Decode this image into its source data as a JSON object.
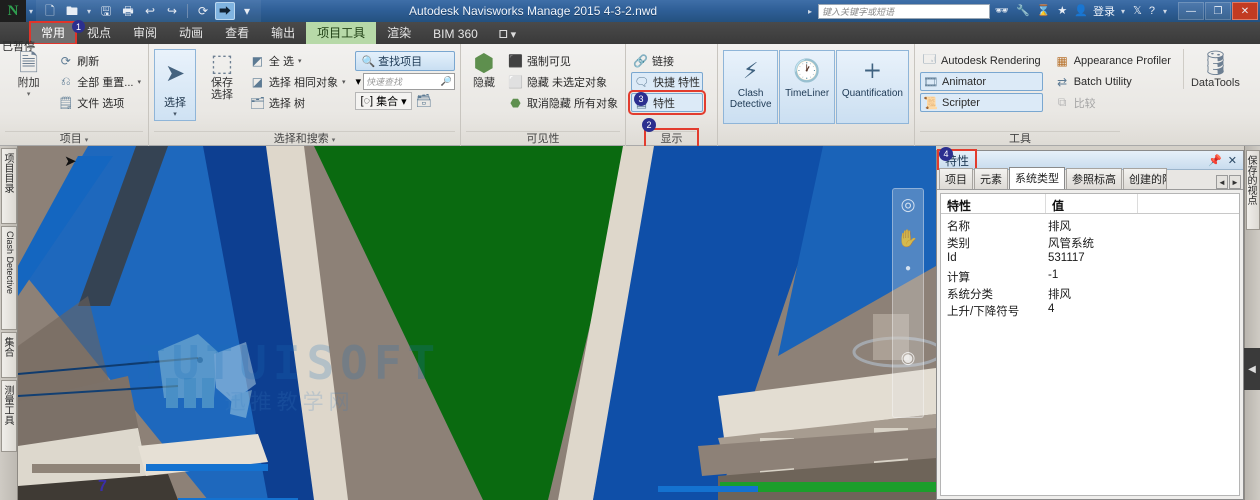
{
  "titlebar": {
    "app_title": "Autodesk Navisworks Manage 2015   4-3-2.nwd",
    "search_placeholder": "键入关键字或短语",
    "login_label": "登录",
    "icons": [
      "save-icon",
      "open-icon",
      "print-icon",
      "undo-icon",
      "redo-icon",
      "refresh-icon",
      "select-cursor-icon",
      "qat-dropdown-icon"
    ],
    "right_icons": [
      "binoculars-icon",
      "wrench-icon",
      "exchange-icon",
      "star-icon",
      "user-icon",
      "x-icon",
      "help-icon"
    ],
    "window_buttons": [
      "minimize",
      "maximize",
      "close"
    ]
  },
  "tabs": [
    {
      "label": "常用",
      "state": "active",
      "badge": "1"
    },
    {
      "label": "视点",
      "state": "normal"
    },
    {
      "label": "审阅",
      "state": "normal"
    },
    {
      "label": "动画",
      "state": "normal"
    },
    {
      "label": "查看",
      "state": "normal"
    },
    {
      "label": "输出",
      "state": "normal"
    },
    {
      "label": "项目工具",
      "state": "green"
    },
    {
      "label": "渲染",
      "state": "normal"
    },
    {
      "label": "BIM 360",
      "state": "normal"
    }
  ],
  "status_left": "已暂停",
  "ribbon": {
    "project": {
      "title": "项目",
      "big": {
        "label": "附加",
        "icon": "attach-file-icon"
      },
      "items": [
        {
          "label": "刷新",
          "icon": "refresh-icon",
          "caret": false
        },
        {
          "label": "全部 重置...",
          "icon": "reset-all-icon",
          "caret": true
        },
        {
          "label": "文件 选项",
          "icon": "file-options-icon",
          "caret": false
        }
      ]
    },
    "select_search": {
      "title": "选择和搜索",
      "select_big": {
        "label": "选择",
        "icon": "arrow-cursor-icon"
      },
      "save_selection": {
        "label_line1": "保存",
        "label_line2": "选择",
        "icon": "save-selection-icon"
      },
      "items": [
        {
          "label": "全 选",
          "icon": "select-all-icon",
          "caret": true
        },
        {
          "label": "选择 相同对象",
          "icon": "select-same-icon",
          "caret": true
        },
        {
          "label": "选择 树",
          "icon": "selection-tree-icon",
          "caret": false
        }
      ],
      "find_items": {
        "label": "查找项目",
        "icon": "find-items-icon"
      },
      "quick_find_placeholder": "快速查找",
      "quick_find_icon": "magnifier-icon",
      "sets": {
        "label": "集合",
        "icon": "sets-icon",
        "caret": true
      },
      "sets_extra_icon": "sets-manage-icon"
    },
    "visibility": {
      "title": "可见性",
      "big": {
        "label": "隐藏",
        "icon": "hide-box-icon"
      },
      "items": [
        {
          "label": "强制可见",
          "icon": "require-visible-icon"
        },
        {
          "label": "隐藏 未选定对象",
          "icon": "hide-unselected-icon"
        },
        {
          "label": "取消隐藏 所有对象",
          "icon": "unhide-all-icon"
        }
      ]
    },
    "display": {
      "title": "显示",
      "items": [
        {
          "label": "链接",
          "icon": "links-icon",
          "style": "plain"
        },
        {
          "label": "快捷 特性",
          "icon": "quick-properties-icon",
          "style": "boxed"
        },
        {
          "label": "特性",
          "icon": "properties-icon",
          "style": "highlighted"
        }
      ]
    },
    "tools_big": [
      {
        "line1": "Clash",
        "line2": "Detective",
        "icon": "clash-detective-icon"
      },
      {
        "line1": "TimeLiner",
        "line2": "",
        "icon": "timeliner-icon"
      },
      {
        "line1": "Quantification",
        "line2": "",
        "icon": "quantification-icon"
      }
    ],
    "tools": {
      "title": "工具",
      "col_a": [
        {
          "label": "Autodesk Rendering",
          "icon": "rendering-icon",
          "style": "plain"
        },
        {
          "label": "Animator",
          "icon": "animator-icon",
          "style": "boxed"
        },
        {
          "label": "Scripter",
          "icon": "scripter-icon",
          "style": "boxed"
        }
      ],
      "col_b": [
        {
          "label": "Appearance Profiler",
          "icon": "appearance-profiler-icon",
          "style": "plain"
        },
        {
          "label": "Batch Utility",
          "icon": "batch-utility-icon",
          "style": "plain"
        },
        {
          "label": "比较",
          "icon": "compare-icon",
          "style": "disabled"
        }
      ],
      "datatools": {
        "label": "DataTools",
        "icon": "datatools-icon"
      }
    },
    "callouts": [
      {
        "number": "1",
        "target": "tab-常用"
      },
      {
        "number": "2",
        "target": "display-panel-title"
      },
      {
        "number": "3",
        "target": "properties-button"
      },
      {
        "number": "4",
        "target": "properties-panel-title"
      }
    ]
  },
  "left_dock": [
    {
      "label": "项目目录",
      "script": "cjk"
    },
    {
      "label": "Clash Detective",
      "script": "latin"
    },
    {
      "label": "集合",
      "script": "cjk"
    },
    {
      "label": "测量工具",
      "script": "cjk"
    }
  ],
  "right_dock": [
    {
      "label": "保存的视点",
      "script": "cjk"
    }
  ],
  "viewport": {
    "watermark_text": "TUTUISOFT",
    "watermark_sub": "迅推教学网",
    "marker_number": "7",
    "navbar_icons": [
      "steering-wheel-icon",
      "pan-hand-icon",
      "zoom-dot-icon",
      "orbit-icon"
    ],
    "colors": {
      "duct_blue_light": "#1466c0",
      "duct_blue_dark": "#0b3f8f",
      "duct_green": "#0a6a10",
      "ceiling_grey": "#8d8177",
      "slab_cream": "#ded7cb",
      "dark_grey": "#3d3730"
    }
  },
  "properties_panel": {
    "title": "特性",
    "header_icons": [
      "auto-hide-pin-icon",
      "close-icon"
    ],
    "tabs": [
      {
        "label": "项目",
        "active": false
      },
      {
        "label": "元素",
        "active": false
      },
      {
        "label": "系统类型",
        "active": true
      },
      {
        "label": "参照标高",
        "active": false
      },
      {
        "label": "创建的阶",
        "active": false
      }
    ],
    "tab_scroll": [
      "◄",
      "►"
    ],
    "columns": [
      "特性",
      "值",
      ""
    ],
    "rows": [
      {
        "name": "名称",
        "value": "排风"
      },
      {
        "name": "类别",
        "value": "风管系统"
      },
      {
        "name": "Id",
        "value": "531117"
      },
      {
        "name": "计算",
        "value": "-1"
      },
      {
        "name": "系统分类",
        "value": "排风"
      },
      {
        "name": "上升/下降符号",
        "value": "4"
      }
    ]
  }
}
